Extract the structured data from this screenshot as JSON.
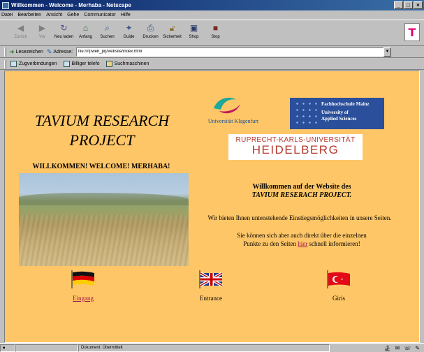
{
  "window": {
    "title": "Willkommen - Welcome - Merhaba - Netscape",
    "minimize": "_",
    "maximize": "□",
    "close": "×"
  },
  "menu": [
    "Datei",
    "Bearbeiten",
    "Ansicht",
    "Gehe",
    "Communicator",
    "Hilfe"
  ],
  "toolbar": {
    "buttons": [
      {
        "label": "Zurück",
        "icon": "back-arrow-icon",
        "disabled": true
      },
      {
        "label": "Vor",
        "icon": "forward-arrow-icon",
        "disabled": true
      },
      {
        "label": "Neu laden",
        "icon": "reload-icon",
        "disabled": false
      },
      {
        "label": "Anfang",
        "icon": "home-icon",
        "disabled": false
      },
      {
        "label": "Suchen",
        "icon": "search-icon",
        "disabled": false
      },
      {
        "label": "Guide",
        "icon": "guide-icon",
        "disabled": false
      },
      {
        "label": "Drucken",
        "icon": "print-icon",
        "disabled": false
      },
      {
        "label": "Sicherheit",
        "icon": "lock-icon",
        "disabled": false
      },
      {
        "label": "Shop",
        "icon": "shop-icon",
        "disabled": false
      },
      {
        "label": "Stop",
        "icon": "stop-icon",
        "disabled": false
      }
    ],
    "brand_glyph": "T"
  },
  "location": {
    "bookmarks_label": "Lesezeichen",
    "address_label": "Adresse:",
    "url": "file:///f|/web_prj/website/index.html"
  },
  "personal_toolbar": [
    "Zugverbindungen",
    "Billiger telefo",
    "Suchmaschinen"
  ],
  "page": {
    "title_line1": "TAVIUM RESEARCH",
    "title_line2": "PROJECT",
    "welcome": "WILLKOMMEN! WELCOME! MERHABA!",
    "logo_klagenfurt": "Universität Klagenfurt",
    "logo_fh_lines": [
      "Fachhochschule Mainz",
      "University of",
      "Applied Sciences"
    ],
    "logo_heidelberg_line1": "RUPRECHT-KARLS-UNIVERSITÄT",
    "logo_heidelberg_line2": "HEIDELBERG",
    "intro_line1": "Willkommen auf der Website des",
    "intro_line2": "TAVIUM RESERACH PROJECT.",
    "offer_text": "Wir bieten Ihnen untenstehende Einstiegsmöglichkeiten in unsere Seiten.",
    "direct_prefix": "Sie können sich aber auch direkt über die einzelnen",
    "direct_mid": "Punkte zu den Seiten",
    "direct_link": "hier",
    "direct_suffix": "schnell informieren!",
    "entries": [
      {
        "label": "Eingang",
        "flag": "germany-flag",
        "link": true
      },
      {
        "label": "Entrance",
        "flag": "uk-flag",
        "link": false
      },
      {
        "label": "Giris",
        "flag": "turkey-flag",
        "link": false
      }
    ],
    "background_color": "#ffc667",
    "link_color": "#a0154b"
  },
  "status": {
    "message": "Dokument: Übermittelt"
  }
}
